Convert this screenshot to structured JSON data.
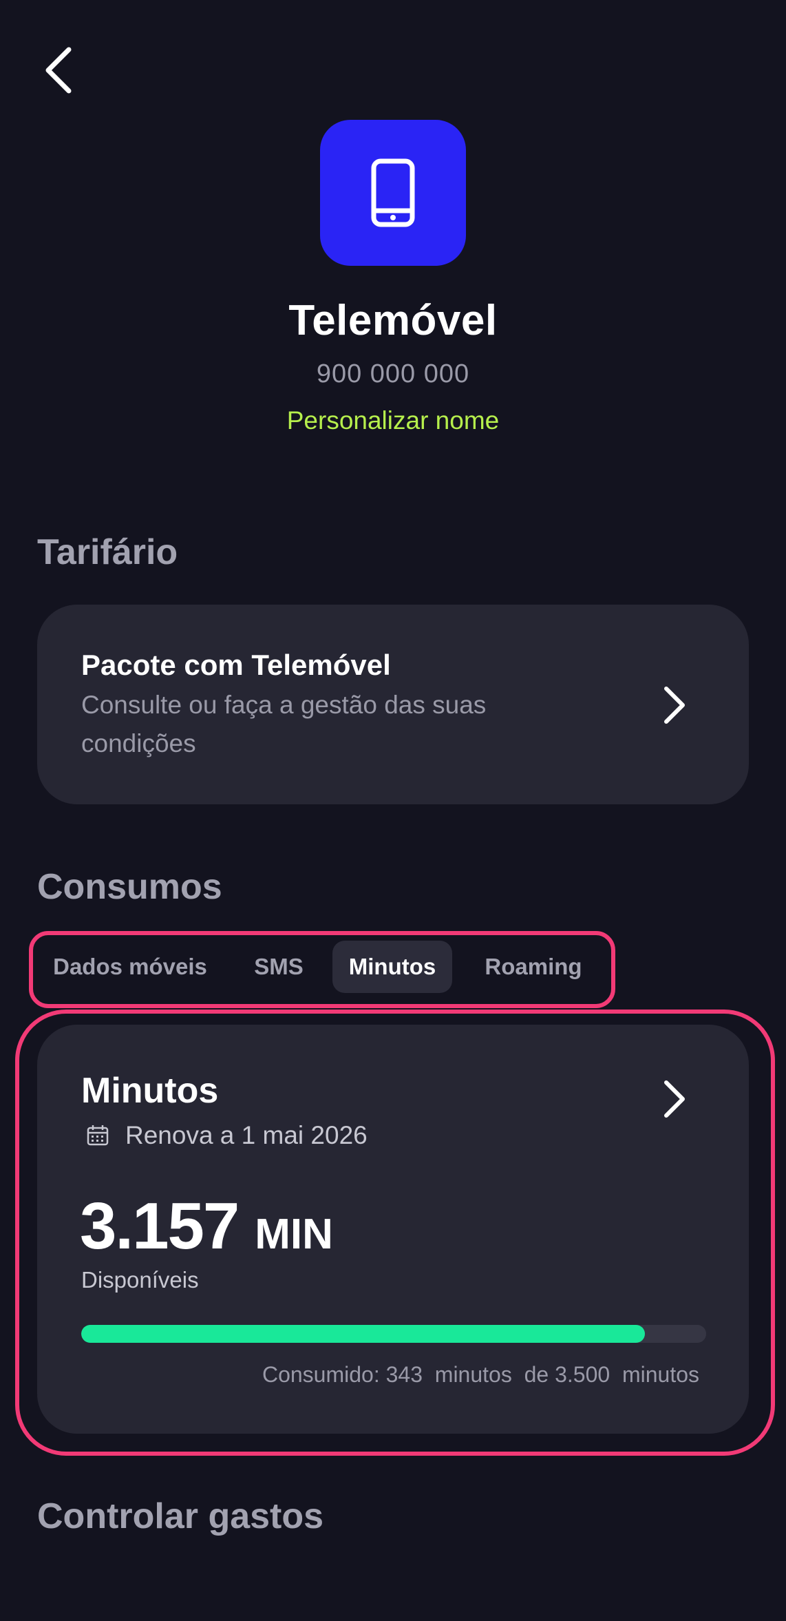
{
  "header": {
    "back_icon": "chevron-left-icon"
  },
  "device": {
    "icon": "smartphone-icon",
    "icon_bg_color": "#2a24f5",
    "title": "Telemóvel",
    "number": "900 000 000",
    "rename_label": "Personalizar nome",
    "rename_color": "#b6ef4c"
  },
  "tarifario": {
    "heading": "Tarifário",
    "card": {
      "title": "Pacote com Telemóvel",
      "subtitle": "Consulte ou faça a gestão das suas condições",
      "chevron_icon": "chevron-right-icon"
    }
  },
  "consumos": {
    "heading": "Consumos",
    "tabs": [
      {
        "label": "Dados móveis",
        "selected": false
      },
      {
        "label": "SMS",
        "selected": false
      },
      {
        "label": "Minutos",
        "selected": true
      },
      {
        "label": "Roaming",
        "selected": false
      }
    ],
    "highlight_color": "#f23a76",
    "card": {
      "title": "Minutos",
      "chevron_icon": "chevron-right-icon",
      "calendar_icon": "calendar-icon",
      "renew_text": "Renova a 1 mai 2026",
      "amount": "3.157",
      "unit": "MIN",
      "available_label": "Disponíveis",
      "progress_fraction": 0.902,
      "progress_color": "#19e899",
      "consumed_text": "Consumido: 343  minutos  de 3.500  minutos"
    }
  },
  "gastos": {
    "heading": "Controlar gastos"
  }
}
